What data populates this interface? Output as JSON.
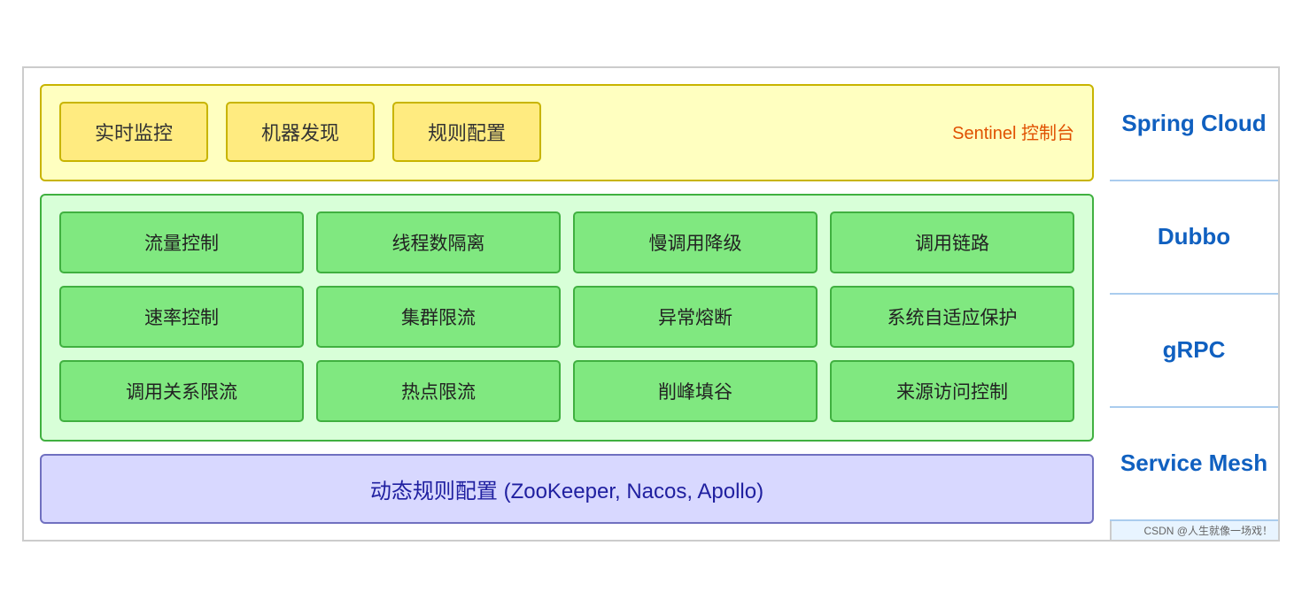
{
  "sentinel_panel": {
    "boxes": [
      {
        "label": "实时监控"
      },
      {
        "label": "机器发现"
      },
      {
        "label": "规则配置"
      }
    ],
    "panel_label": "Sentinel 控制台"
  },
  "features_panel": {
    "rows": [
      [
        {
          "label": "流量控制"
        },
        {
          "label": "线程数隔离"
        },
        {
          "label": "慢调用降级"
        },
        {
          "label": "调用链路"
        }
      ],
      [
        {
          "label": "速率控制"
        },
        {
          "label": "集群限流"
        },
        {
          "label": "异常熔断"
        },
        {
          "label": "系统自适应保护"
        }
      ],
      [
        {
          "label": "调用关系限流"
        },
        {
          "label": "热点限流"
        },
        {
          "label": "削峰填谷"
        },
        {
          "label": "来源访问控制"
        }
      ]
    ]
  },
  "dynamic_panel": {
    "label": "动态规则配置 (ZooKeeper, Nacos, Apollo)"
  },
  "sidebar": {
    "items": [
      {
        "label": "Spring Cloud"
      },
      {
        "label": "Dubbo"
      },
      {
        "label": "gRPC"
      },
      {
        "label": "Service Mesh"
      }
    ]
  },
  "watermark": "CSDN @人生就像一场戏！"
}
